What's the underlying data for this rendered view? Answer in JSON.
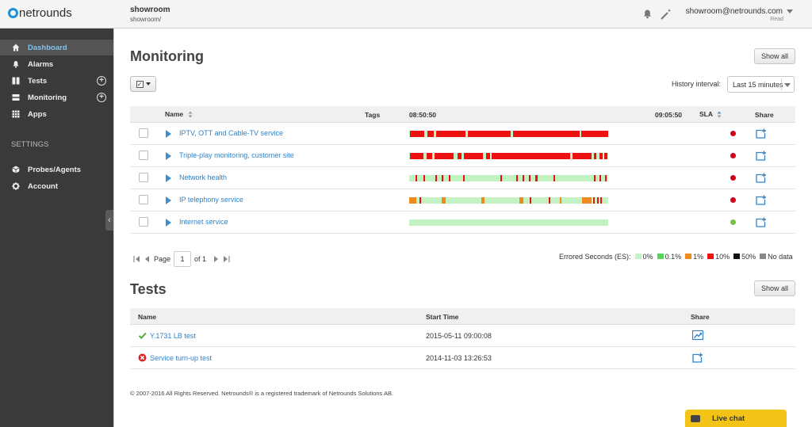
{
  "header": {
    "logo_text": "netrounds",
    "workspace_name": "showroom",
    "workspace_path": "showroom/",
    "user_email": "showroom@netrounds.com",
    "user_role": "Read"
  },
  "sidebar": {
    "items": [
      {
        "label": "Dashboard",
        "icon": "home-icon",
        "active": true
      },
      {
        "label": "Alarms",
        "icon": "bell-icon"
      },
      {
        "label": "Tests",
        "icon": "columns-icon"
      },
      {
        "label": "Monitoring",
        "icon": "monitor-icon"
      },
      {
        "label": "Apps",
        "icon": "grid-icon"
      }
    ],
    "settings_heading": "SETTINGS",
    "settings_items": [
      {
        "label": "Probes/Agents",
        "icon": "cube-icon"
      },
      {
        "label": "Account",
        "icon": "cog-icon"
      }
    ]
  },
  "monitoring": {
    "title": "Monitoring",
    "show_all": "Show all",
    "history_label": "History interval:",
    "history_value": "Last 15 minutes",
    "columns": {
      "name": "Name",
      "tags": "Tags",
      "time_start": "08:50:50",
      "time_end": "09:05:50",
      "sla": "SLA",
      "share": "Share"
    },
    "rows": [
      {
        "name": "IPTV, OTT and Cable-TV service",
        "sla": "#d0021b"
      },
      {
        "name": "Triple-play monitoring, customer site",
        "sla": "#d0021b"
      },
      {
        "name": "Network health",
        "sla": "#d0021b"
      },
      {
        "name": "IP telephony service",
        "sla": "#d0021b"
      },
      {
        "name": "Internet service",
        "sla": "#7ac143"
      }
    ],
    "pager": {
      "page_label": "Page",
      "page": "1",
      "of": "of 1"
    },
    "legend": {
      "title": "Errored Seconds (ES):",
      "items": [
        {
          "label": "0%",
          "color": "#c4f2c4"
        },
        {
          "label": "0.1%",
          "color": "#55d655"
        },
        {
          "label": "1%",
          "color": "#f0891e"
        },
        {
          "label": "10%",
          "color": "#ee1111"
        },
        {
          "label": "50%",
          "color": "#111111"
        },
        {
          "label": "No data",
          "color": "#888888"
        }
      ]
    }
  },
  "tests": {
    "title": "Tests",
    "show_all": "Show all",
    "columns": {
      "name": "Name",
      "start_time": "Start Time",
      "share": "Share"
    },
    "rows": [
      {
        "name": "Y.1731 LB test",
        "start_time": "2015-05-11 09:00:08",
        "status": "passed"
      },
      {
        "name": "Service turn-up test",
        "start_time": "2014-11-03 13:26:53",
        "status": "failed"
      }
    ]
  },
  "footer": "© 2007-2016 All Rights Reserved. Netrounds® is a registered trademark of Netrounds Solutions AB.",
  "livechat": "Live chat",
  "colors": {
    "accent": "#2f83cc",
    "sidebar": "#3a3a3a",
    "active_nav": "#7ec4ef",
    "livechat": "#f3c417"
  }
}
